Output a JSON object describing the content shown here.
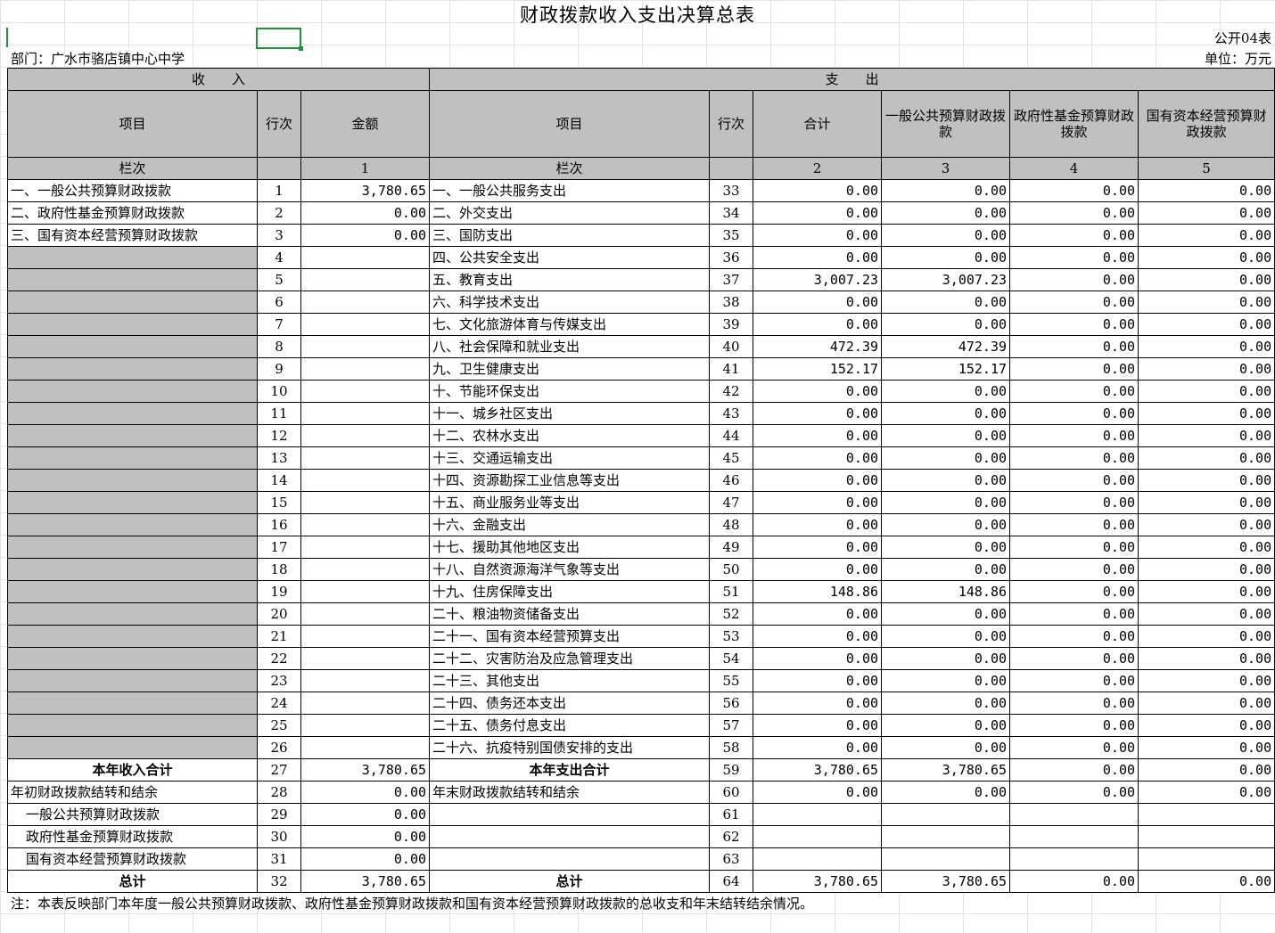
{
  "title": "财政拨款收入支出决算总表",
  "form_no": "公开04表",
  "dept": "部门：广水市骆店镇中心中学",
  "unit": "单位：万元",
  "headers": {
    "income": "收　　入",
    "expense": "支　　出",
    "item": "项目",
    "row_no": "行次",
    "amount": "金额",
    "total": "合计",
    "general": "一般公共预算财政拨款",
    "gov_fund": "政府性基金预算财政拨款",
    "state_capital": "国有资本经营预算财政拨款",
    "col_label": "栏次",
    "col1": "1",
    "col2": "2",
    "col3": "3",
    "col4": "4",
    "col5": "5"
  },
  "rows": [
    {
      "in_item": "一、一般公共预算财政拨款",
      "in_no": "1",
      "in_amt": "3,780.65",
      "ex_item": "一、一般公共服务支出",
      "ex_no": "33",
      "t": "0.00",
      "g": "0.00",
      "f": "0.00",
      "s": "0.00"
    },
    {
      "in_item": "二、政府性基金预算财政拨款",
      "in_no": "2",
      "in_amt": "0.00",
      "ex_item": "二、外交支出",
      "ex_no": "34",
      "t": "0.00",
      "g": "0.00",
      "f": "0.00",
      "s": "0.00"
    },
    {
      "in_item": "三、国有资本经营预算财政拨款",
      "in_no": "3",
      "in_amt": "0.00",
      "ex_item": "三、国防支出",
      "ex_no": "35",
      "t": "0.00",
      "g": "0.00",
      "f": "0.00",
      "s": "0.00"
    },
    {
      "in_item": "",
      "in_no": "4",
      "in_amt": "",
      "ex_item": "四、公共安全支出",
      "ex_no": "36",
      "t": "0.00",
      "g": "0.00",
      "f": "0.00",
      "s": "0.00"
    },
    {
      "in_item": "",
      "in_no": "5",
      "in_amt": "",
      "ex_item": "五、教育支出",
      "ex_no": "37",
      "t": "3,007.23",
      "g": "3,007.23",
      "f": "0.00",
      "s": "0.00"
    },
    {
      "in_item": "",
      "in_no": "6",
      "in_amt": "",
      "ex_item": "六、科学技术支出",
      "ex_no": "38",
      "t": "0.00",
      "g": "0.00",
      "f": "0.00",
      "s": "0.00"
    },
    {
      "in_item": "",
      "in_no": "7",
      "in_amt": "",
      "ex_item": "七、文化旅游体育与传媒支出",
      "ex_no": "39",
      "t": "0.00",
      "g": "0.00",
      "f": "0.00",
      "s": "0.00"
    },
    {
      "in_item": "",
      "in_no": "8",
      "in_amt": "",
      "ex_item": "八、社会保障和就业支出",
      "ex_no": "40",
      "t": "472.39",
      "g": "472.39",
      "f": "0.00",
      "s": "0.00"
    },
    {
      "in_item": "",
      "in_no": "9",
      "in_amt": "",
      "ex_item": "九、卫生健康支出",
      "ex_no": "41",
      "t": "152.17",
      "g": "152.17",
      "f": "0.00",
      "s": "0.00"
    },
    {
      "in_item": "",
      "in_no": "10",
      "in_amt": "",
      "ex_item": "十、节能环保支出",
      "ex_no": "42",
      "t": "0.00",
      "g": "0.00",
      "f": "0.00",
      "s": "0.00"
    },
    {
      "in_item": "",
      "in_no": "11",
      "in_amt": "",
      "ex_item": "十一、城乡社区支出",
      "ex_no": "43",
      "t": "0.00",
      "g": "0.00",
      "f": "0.00",
      "s": "0.00"
    },
    {
      "in_item": "",
      "in_no": "12",
      "in_amt": "",
      "ex_item": "十二、农林水支出",
      "ex_no": "44",
      "t": "0.00",
      "g": "0.00",
      "f": "0.00",
      "s": "0.00"
    },
    {
      "in_item": "",
      "in_no": "13",
      "in_amt": "",
      "ex_item": "十三、交通运输支出",
      "ex_no": "45",
      "t": "0.00",
      "g": "0.00",
      "f": "0.00",
      "s": "0.00"
    },
    {
      "in_item": "",
      "in_no": "14",
      "in_amt": "",
      "ex_item": "十四、资源勘探工业信息等支出",
      "ex_no": "46",
      "t": "0.00",
      "g": "0.00",
      "f": "0.00",
      "s": "0.00"
    },
    {
      "in_item": "",
      "in_no": "15",
      "in_amt": "",
      "ex_item": "十五、商业服务业等支出",
      "ex_no": "47",
      "t": "0.00",
      "g": "0.00",
      "f": "0.00",
      "s": "0.00"
    },
    {
      "in_item": "",
      "in_no": "16",
      "in_amt": "",
      "ex_item": "十六、金融支出",
      "ex_no": "48",
      "t": "0.00",
      "g": "0.00",
      "f": "0.00",
      "s": "0.00"
    },
    {
      "in_item": "",
      "in_no": "17",
      "in_amt": "",
      "ex_item": "十七、援助其他地区支出",
      "ex_no": "49",
      "t": "0.00",
      "g": "0.00",
      "f": "0.00",
      "s": "0.00"
    },
    {
      "in_item": "",
      "in_no": "18",
      "in_amt": "",
      "ex_item": "十八、自然资源海洋气象等支出",
      "ex_no": "50",
      "t": "0.00",
      "g": "0.00",
      "f": "0.00",
      "s": "0.00"
    },
    {
      "in_item": "",
      "in_no": "19",
      "in_amt": "",
      "ex_item": "十九、住房保障支出",
      "ex_no": "51",
      "t": "148.86",
      "g": "148.86",
      "f": "0.00",
      "s": "0.00"
    },
    {
      "in_item": "",
      "in_no": "20",
      "in_amt": "",
      "ex_item": "二十、粮油物资储备支出",
      "ex_no": "52",
      "t": "0.00",
      "g": "0.00",
      "f": "0.00",
      "s": "0.00"
    },
    {
      "in_item": "",
      "in_no": "21",
      "in_amt": "",
      "ex_item": "二十一、国有资本经营预算支出",
      "ex_no": "53",
      "t": "0.00",
      "g": "0.00",
      "f": "0.00",
      "s": "0.00"
    },
    {
      "in_item": "",
      "in_no": "22",
      "in_amt": "",
      "ex_item": "二十二、灾害防治及应急管理支出",
      "ex_no": "54",
      "t": "0.00",
      "g": "0.00",
      "f": "0.00",
      "s": "0.00"
    },
    {
      "in_item": "",
      "in_no": "23",
      "in_amt": "",
      "ex_item": "二十三、其他支出",
      "ex_no": "55",
      "t": "0.00",
      "g": "0.00",
      "f": "0.00",
      "s": "0.00"
    },
    {
      "in_item": "",
      "in_no": "24",
      "in_amt": "",
      "ex_item": "二十四、债务还本支出",
      "ex_no": "56",
      "t": "0.00",
      "g": "0.00",
      "f": "0.00",
      "s": "0.00"
    },
    {
      "in_item": "",
      "in_no": "25",
      "in_amt": "",
      "ex_item": "二十五、债务付息支出",
      "ex_no": "57",
      "t": "0.00",
      "g": "0.00",
      "f": "0.00",
      "s": "0.00"
    },
    {
      "in_item": "",
      "in_no": "26",
      "in_amt": "",
      "ex_item": "二十六、抗疫特别国债安排的支出",
      "ex_no": "58",
      "t": "0.00",
      "g": "0.00",
      "f": "0.00",
      "s": "0.00"
    }
  ],
  "subtotal": {
    "in_item": "本年收入合计",
    "in_no": "27",
    "in_amt": "3,780.65",
    "ex_item": "本年支出合计",
    "ex_no": "59",
    "t": "3,780.65",
    "g": "3,780.65",
    "f": "0.00",
    "s": "0.00"
  },
  "carry": {
    "in_item": "年初财政拨款结转和结余",
    "in_no": "28",
    "in_amt": "0.00",
    "ex_item": "年末财政拨款结转和结余",
    "ex_no": "60",
    "t": "0.00",
    "g": "0.00",
    "f": "0.00",
    "s": "0.00"
  },
  "carry_detail": [
    {
      "in_item": "一般公共预算财政拨款",
      "in_no": "29",
      "in_amt": "0.00",
      "ex_no": "61"
    },
    {
      "in_item": "政府性基金预算财政拨款",
      "in_no": "30",
      "in_amt": "0.00",
      "ex_no": "62"
    },
    {
      "in_item": "国有资本经营预算财政拨款",
      "in_no": "31",
      "in_amt": "0.00",
      "ex_no": "63"
    }
  ],
  "grand": {
    "in_item": "总计",
    "in_no": "32",
    "in_amt": "3,780.65",
    "ex_item": "总计",
    "ex_no": "64",
    "t": "3,780.65",
    "g": "3,780.65",
    "f": "0.00",
    "s": "0.00"
  },
  "note": "注：本表反映部门本年度一般公共预算财政拨款、政府性基金预算财政拨款和国有资本经营预算财政拨款的总收支和年末结转结余情况。"
}
